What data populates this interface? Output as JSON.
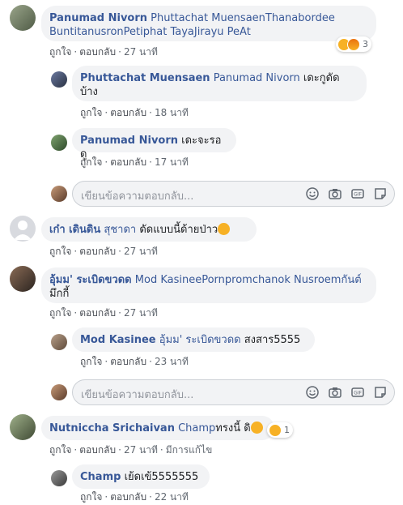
{
  "c1": {
    "name": "Panumad Nivorn",
    "text": "Phuttachat MuensaenThanabordee BuntitanusronPetiphat TayaJirayu PeAt",
    "like": "ถูกใจ",
    "reply": "ตอบกลับ",
    "time": "27 นาที",
    "reaction_count": "3"
  },
  "r1": {
    "name": "Phuttachat Muensaen",
    "tag": "Panumad Nivorn",
    "text": "เดะกูดัดบ้าง",
    "like": "ถูกใจ",
    "reply": "ตอบกลับ",
    "time": "18 นาที"
  },
  "r2": {
    "name": "Panumad Nivorn",
    "text": "เดะจะรอดู",
    "like": "ถูกใจ",
    "reply": "ตอบกลับ",
    "time": "17 นาที"
  },
  "reply_box_1": {
    "placeholder": "เขียนข้อความตอบกลับ..."
  },
  "c2": {
    "name": "เก๋า เดินดิน",
    "tag": "สุชาดา",
    "text": "ดัดแบบนี้ด้ายป่าว",
    "like": "ถูกใจ",
    "reply": "ตอบกลับ",
    "time": "27 นาที"
  },
  "c3": {
    "name": "อุ้มม' ระเบิดขวดด",
    "tag": "Mod KasineePornpromchanok Nusroemกันต์",
    "text": "มึกกี้",
    "like": "ถูกใจ",
    "reply": "ตอบกลับ",
    "time": "27 นาที"
  },
  "r3": {
    "name": "Mod Kasinee",
    "tag": "อุ้มม' ระเบิดขวดด",
    "text": "สงสาร5555",
    "like": "ถูกใจ",
    "reply": "ตอบกลับ",
    "time": "23 นาที"
  },
  "reply_box_2": {
    "placeholder": "เขียนข้อความตอบกลับ..."
  },
  "c4": {
    "name": "Nutniccha Srichaivan",
    "tag": "Champ",
    "text": "ทรงนี้ ดิ",
    "like": "ถูกใจ",
    "reply": "ตอบกลับ",
    "time": "27 นาที",
    "edited": "มีการแก้ไข",
    "reaction_count": "1"
  },
  "r4": {
    "name": "Champ",
    "text": "เย้ดเข้5555555",
    "like": "ถูกใจ",
    "reply": "ตอบกลับ",
    "time": "22 นาที"
  }
}
